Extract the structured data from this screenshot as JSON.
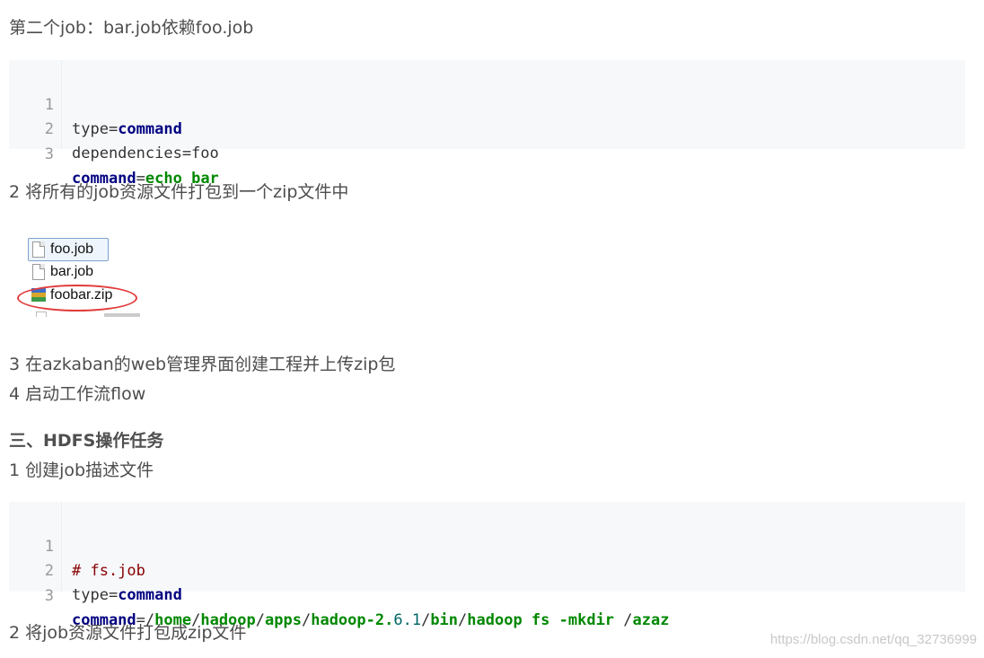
{
  "paragraphs": {
    "p1": "第二个job：bar.job依赖foo.job",
    "p2": "2 将所有的job资源文件打包到一个zip文件中",
    "p3": "3 在azkaban的web管理界面创建工程并上传zip包",
    "p4": "4 启动工作流flow",
    "h1": "三、HDFS操作任务",
    "p5": "1 创建job描述文件",
    "p6": "2 将job资源文件打包成zip文件"
  },
  "code1": {
    "line_numbers": [
      "1",
      "2",
      "3"
    ],
    "lines": {
      "l1": {
        "a": "type=",
        "b": "command"
      },
      "l2": {
        "a": "dependencies=foo"
      },
      "l3": {
        "a": "command",
        "b": "=",
        "c": "echo bar"
      }
    }
  },
  "code2": {
    "line_numbers": [
      "1",
      "2",
      "3"
    ],
    "lines": {
      "l1": {
        "a": "# fs.job"
      },
      "l2": {
        "a": "type=",
        "b": "command"
      },
      "l3": {
        "a": "command",
        "b": "=/",
        "c": "home",
        "d": "/",
        "e": "hadoop",
        "f": "/",
        "g": "apps",
        "h": "/",
        "i": "hadoop-2.",
        "j": "6.1",
        "k": "/",
        "l": "bin",
        "m": "/",
        "n": "hadoop fs -mkdir",
        "o": " /",
        "p": "azaz"
      }
    }
  },
  "file_list": {
    "items": [
      "foo.job",
      "bar.job",
      "foobar.zip"
    ],
    "selected": "foo.job",
    "highlighted": "foobar.zip",
    "highlight_color": "#e23b3b"
  },
  "watermark": "https://blog.csdn.net/qq_32736999"
}
